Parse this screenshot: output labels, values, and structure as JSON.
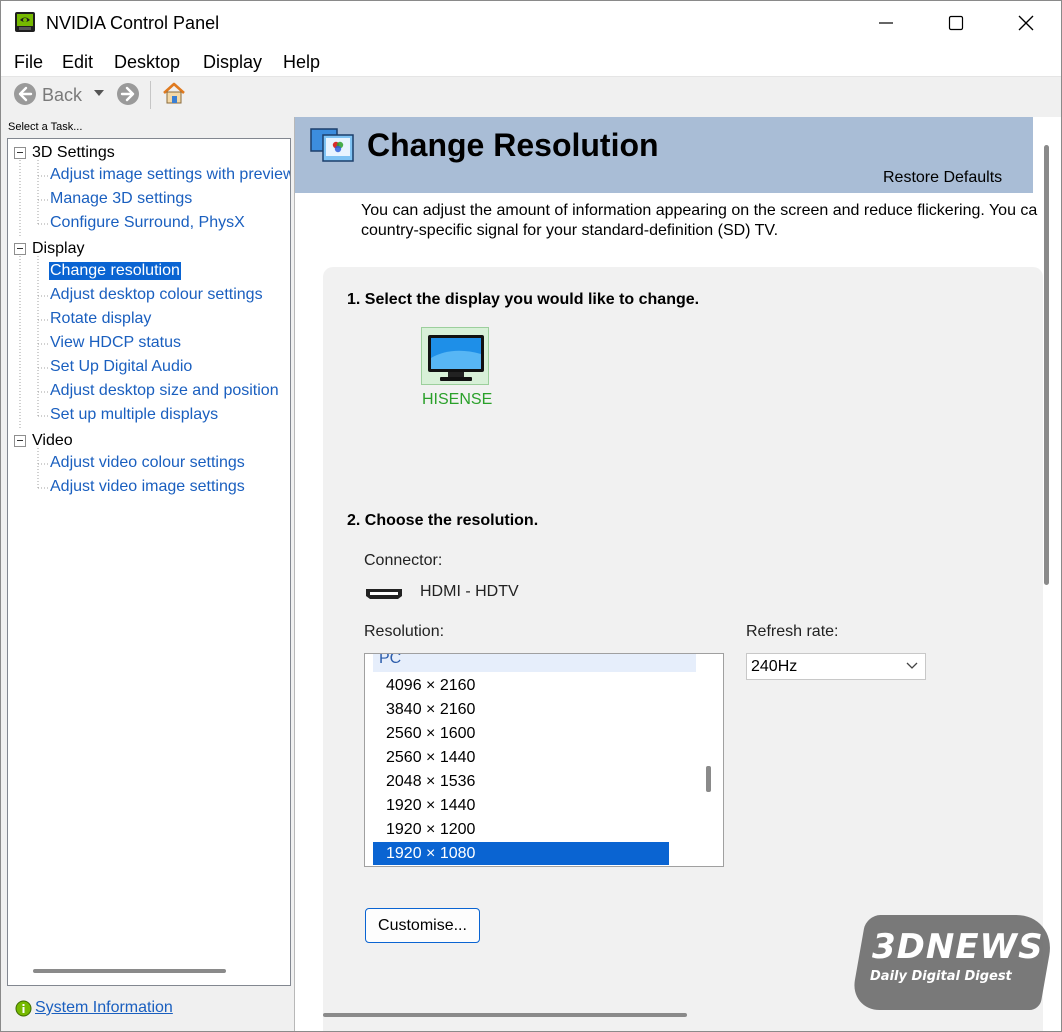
{
  "window": {
    "title": "NVIDIA Control Panel"
  },
  "menu": [
    "File",
    "Edit",
    "Desktop",
    "Display",
    "Help"
  ],
  "toolbar": {
    "back_label": "Back"
  },
  "task_pane": {
    "label": "Select a Task...",
    "groups": [
      {
        "name": "3D Settings",
        "items": [
          "Adjust image settings with preview",
          "Manage 3D settings",
          "Configure Surround, PhysX"
        ]
      },
      {
        "name": "Display",
        "items": [
          "Change resolution",
          "Adjust desktop colour settings",
          "Rotate display",
          "View HDCP status",
          "Set Up Digital Audio",
          "Adjust desktop size and position",
          "Set up multiple displays"
        ]
      },
      {
        "name": "Video",
        "items": [
          "Adjust video colour settings",
          "Adjust video image settings"
        ]
      }
    ],
    "selected_item": "Change resolution",
    "system_info_link": "System Information"
  },
  "page": {
    "title": "Change Resolution",
    "restore_defaults": "Restore Defaults",
    "description_line1": "You can adjust the amount of information appearing on the screen and reduce flickering. You ca",
    "description_line2": "country-specific signal for your standard-definition (SD) TV.",
    "step1_label": "1. Select the display you would like to change.",
    "display_name": "HISENSE",
    "step2_label": "2. Choose the resolution.",
    "connector_label": "Connector:",
    "connector_value": "HDMI - HDTV",
    "resolution_label": "Resolution:",
    "refresh_label": "Refresh rate:",
    "resolution_group": "PC",
    "resolutions": [
      "4096 × 2160",
      "3840 × 2160",
      "2560 × 1600",
      "2560 × 1440",
      "2048 × 1536",
      "1920 × 1440",
      "1920 × 1200",
      "1920 × 1080"
    ],
    "selected_resolution": "1920 × 1080",
    "refresh_rate": "240Hz",
    "customise_button": "Customise..."
  },
  "watermark": {
    "logo": "3DNEWS",
    "tagline": "Daily Digital Digest"
  },
  "colors": {
    "banner": "#a9bdd6",
    "selection": "#0a64d2",
    "link": "#1a5fbf",
    "display_name": "#2aa02a"
  }
}
